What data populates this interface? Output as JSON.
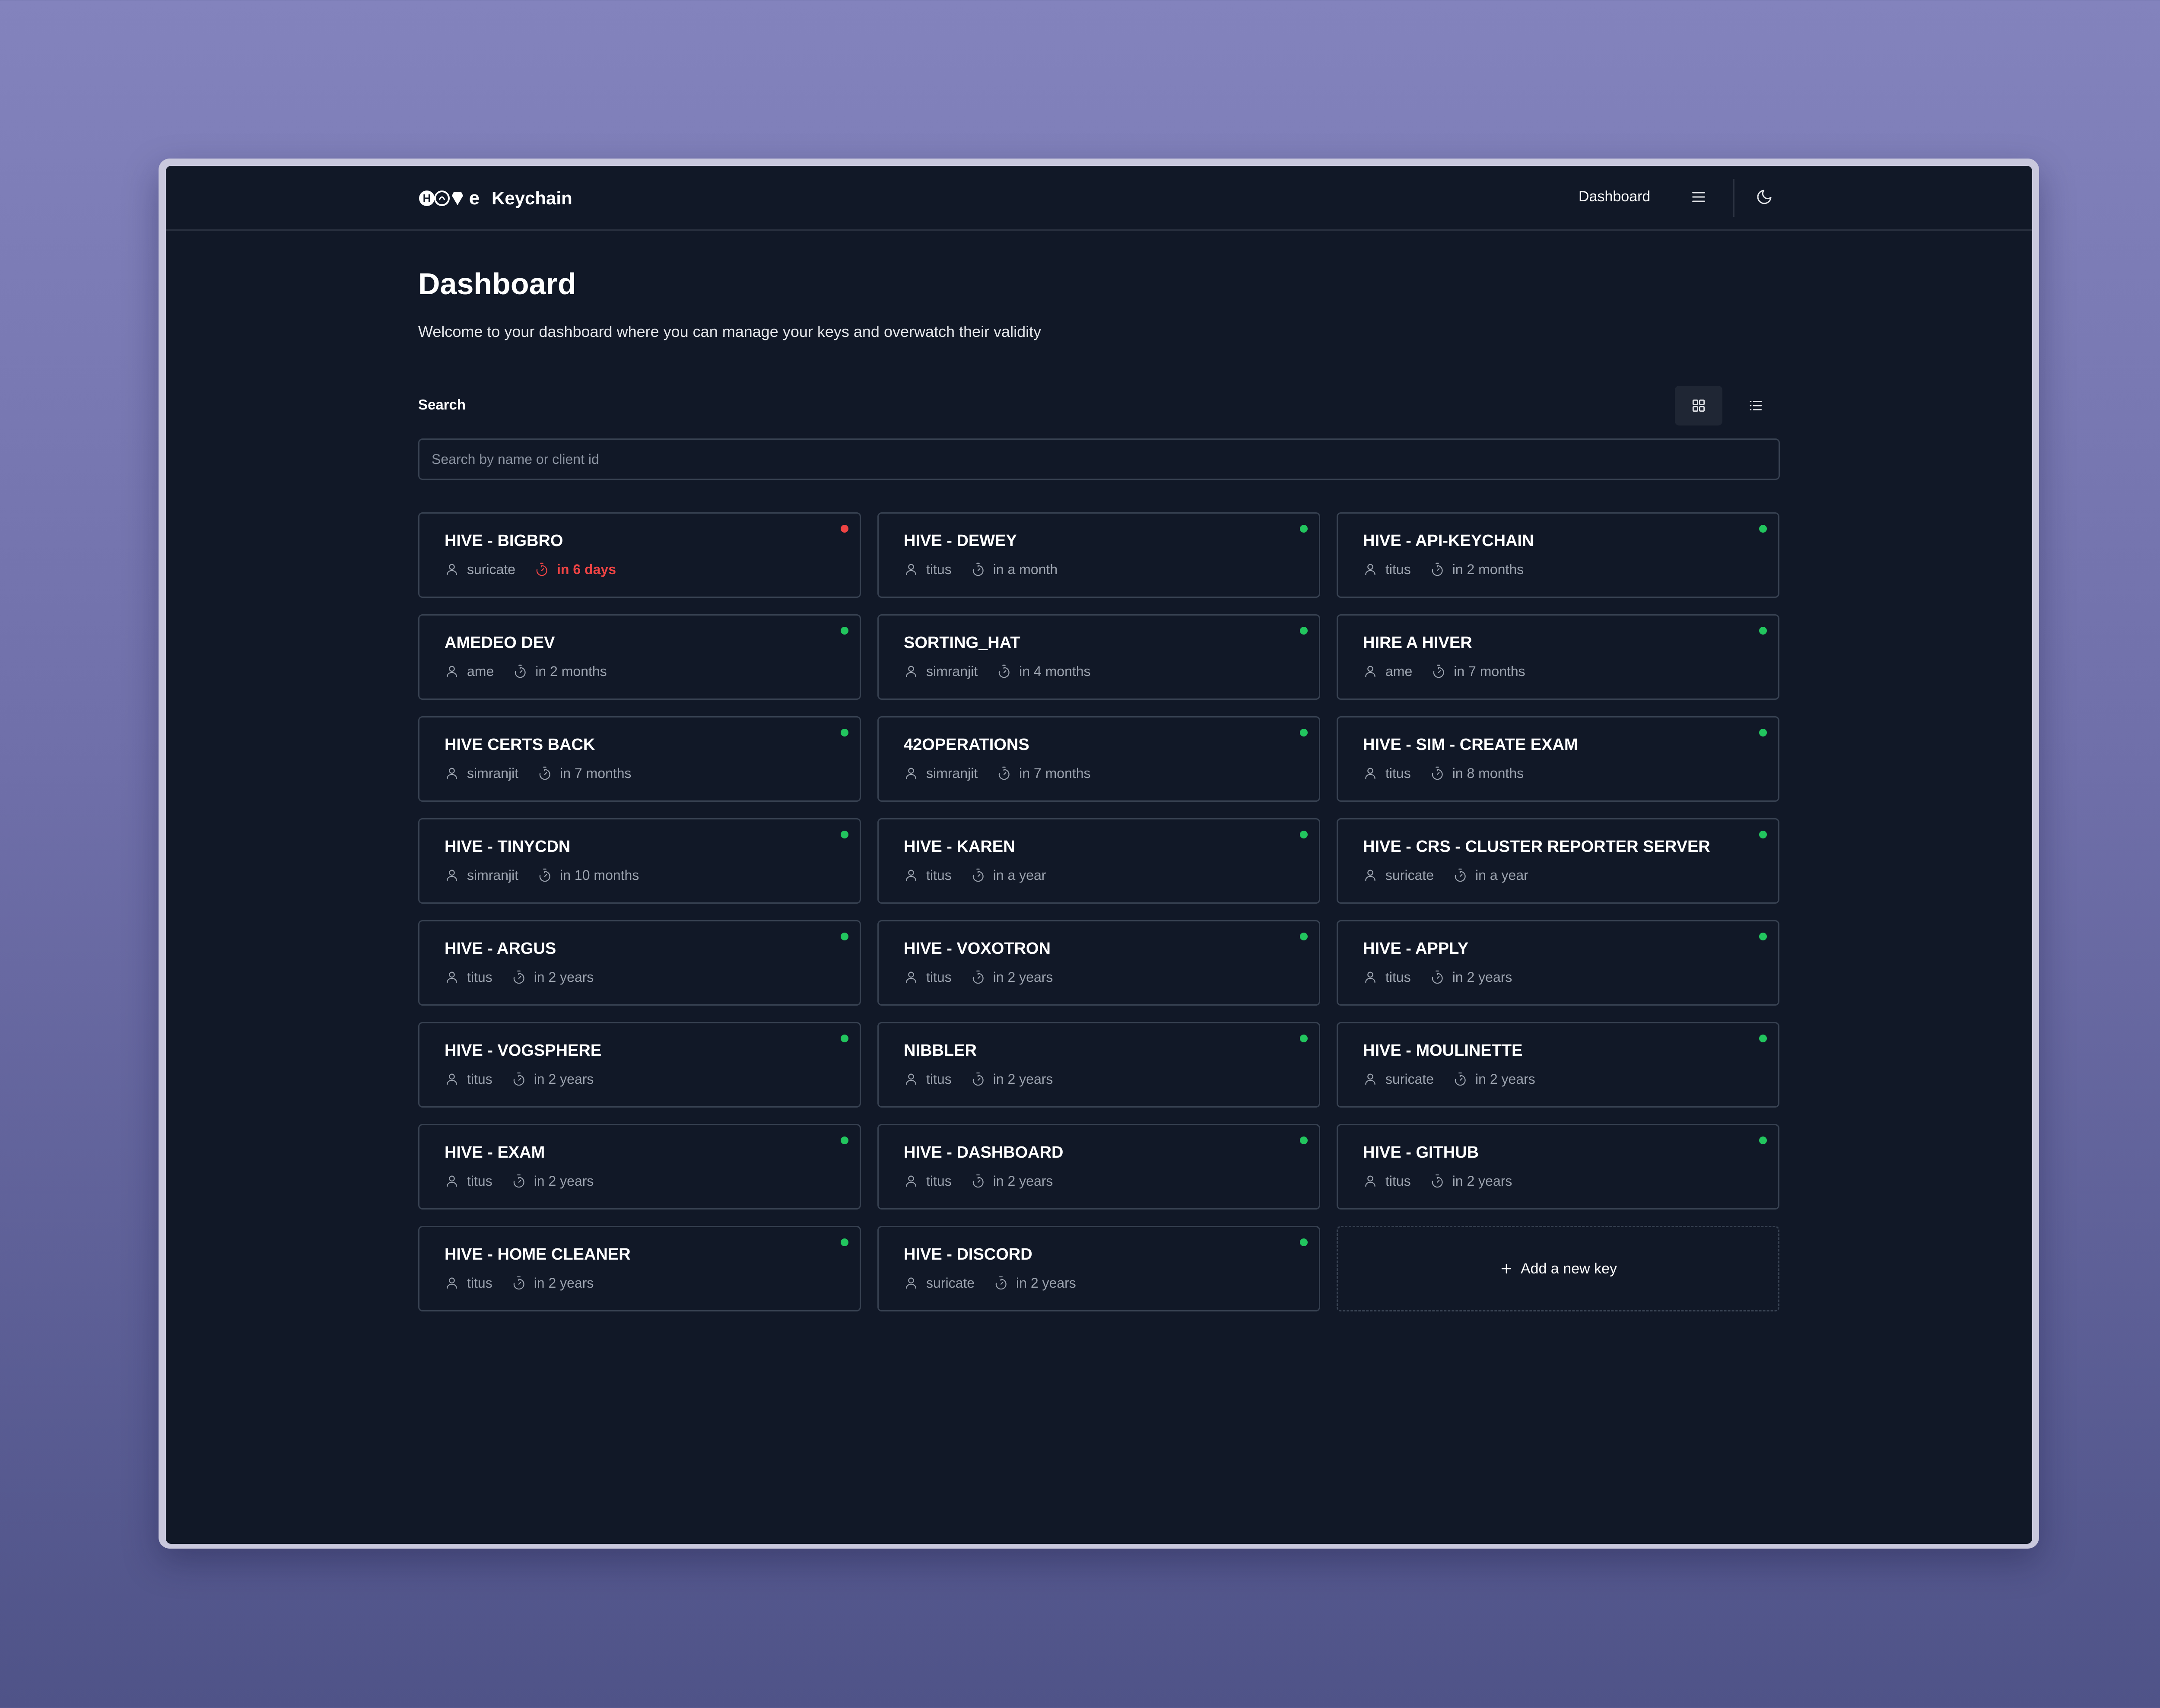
{
  "header": {
    "brand": "Keychain",
    "nav_dashboard": "Dashboard",
    "menu_icon": "menu-icon",
    "theme_icon": "moon-icon"
  },
  "page": {
    "title": "Dashboard",
    "subtitle": "Welcome to your dashboard where you can manage your keys and overwatch their validity"
  },
  "search": {
    "label": "Search",
    "placeholder": "Search by name or client id"
  },
  "colors": {
    "background": "#111827",
    "border": "#374151",
    "status_ok": "#22c55e",
    "status_expiring": "#ef4444"
  },
  "keys": [
    {
      "name": "HIVE - BIGBRO",
      "owner": "suricate",
      "expiry": "in 6 days",
      "status": "expiring"
    },
    {
      "name": "HIVE - DEWEY",
      "owner": "titus",
      "expiry": "in a month",
      "status": "ok"
    },
    {
      "name": "HIVE - API-KEYCHAIN",
      "owner": "titus",
      "expiry": "in 2 months",
      "status": "ok"
    },
    {
      "name": "AMEDEO DEV",
      "owner": "ame",
      "expiry": "in 2 months",
      "status": "ok"
    },
    {
      "name": "SORTING_HAT",
      "owner": "simranjit",
      "expiry": "in 4 months",
      "status": "ok"
    },
    {
      "name": "HIRE A HIVER",
      "owner": "ame",
      "expiry": "in 7 months",
      "status": "ok"
    },
    {
      "name": "HIVE CERTS BACK",
      "owner": "simranjit",
      "expiry": "in 7 months",
      "status": "ok"
    },
    {
      "name": "42OPERATIONS",
      "owner": "simranjit",
      "expiry": "in 7 months",
      "status": "ok"
    },
    {
      "name": "HIVE - SIM - CREATE EXAM",
      "owner": "titus",
      "expiry": "in 8 months",
      "status": "ok"
    },
    {
      "name": "HIVE - TINYCDN",
      "owner": "simranjit",
      "expiry": "in 10 months",
      "status": "ok"
    },
    {
      "name": "HIVE - KAREN",
      "owner": "titus",
      "expiry": "in a year",
      "status": "ok"
    },
    {
      "name": "HIVE - CRS - CLUSTER REPORTER SERVER",
      "owner": "suricate",
      "expiry": "in a year",
      "status": "ok"
    },
    {
      "name": "HIVE - ARGUS",
      "owner": "titus",
      "expiry": "in 2 years",
      "status": "ok"
    },
    {
      "name": "HIVE - VOXOTRON",
      "owner": "titus",
      "expiry": "in 2 years",
      "status": "ok"
    },
    {
      "name": "HIVE - APPLY",
      "owner": "titus",
      "expiry": "in 2 years",
      "status": "ok"
    },
    {
      "name": "HIVE - VOGSPHERE",
      "owner": "titus",
      "expiry": "in 2 years",
      "status": "ok"
    },
    {
      "name": "NIBBLER",
      "owner": "titus",
      "expiry": "in 2 years",
      "status": "ok"
    },
    {
      "name": "HIVE - MOULINETTE",
      "owner": "suricate",
      "expiry": "in 2 years",
      "status": "ok"
    },
    {
      "name": "HIVE - EXAM",
      "owner": "titus",
      "expiry": "in 2 years",
      "status": "ok"
    },
    {
      "name": "HIVE - DASHBOARD",
      "owner": "titus",
      "expiry": "in 2 years",
      "status": "ok"
    },
    {
      "name": "HIVE - GITHUB",
      "owner": "titus",
      "expiry": "in 2 years",
      "status": "ok"
    },
    {
      "name": "HIVE - HOME CLEANER",
      "owner": "titus",
      "expiry": "in 2 years",
      "status": "ok"
    },
    {
      "name": "HIVE - DISCORD",
      "owner": "suricate",
      "expiry": "in 2 years",
      "status": "ok"
    }
  ],
  "add_key": {
    "label": "Add a new key"
  }
}
